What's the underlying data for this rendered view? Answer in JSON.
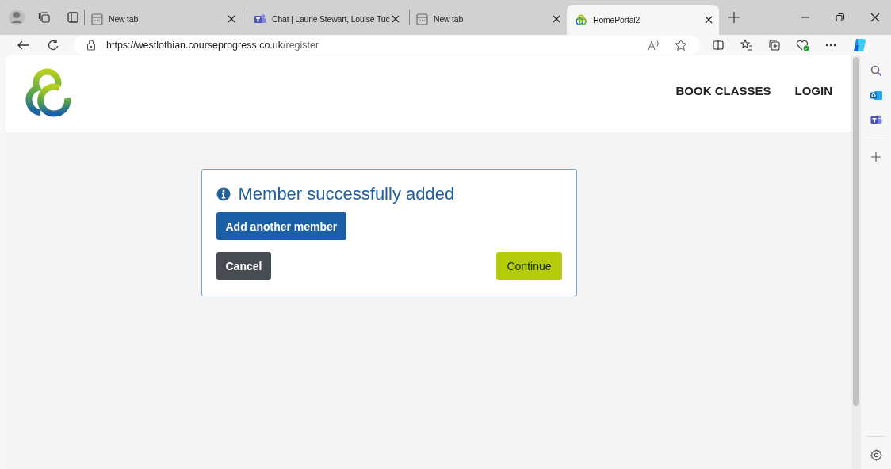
{
  "tabs": [
    {
      "label": "New tab",
      "kind": "blank",
      "selected": false
    },
    {
      "label": "Chat | Laurie Stewart, Louise Tuc",
      "kind": "chat",
      "selected": false
    },
    {
      "label": "New tab",
      "kind": "blank",
      "selected": false
    },
    {
      "label": "HomePortal2",
      "kind": "site",
      "selected": true
    }
  ],
  "address": {
    "host": "https://westlothian.courseprogress.co.uk",
    "path": "/register"
  },
  "nav": [
    "BOOK CLASSES",
    "LOGIN"
  ],
  "dialog": {
    "title": "Member successfully added",
    "add_button": "Add another member",
    "cancel_button": "Cancel",
    "continue_button": "Continue"
  }
}
